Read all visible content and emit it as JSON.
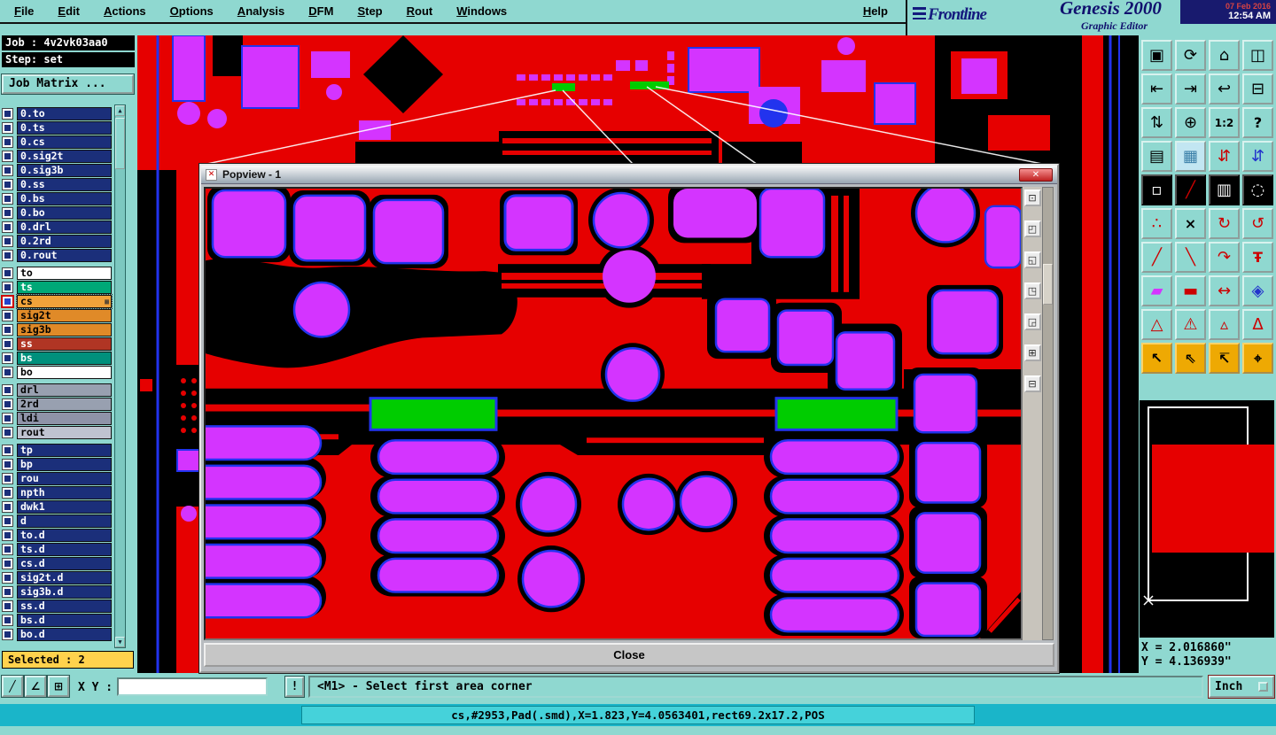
{
  "colors": {
    "desktop": "#8fd8d0",
    "copper_red": "#e60000",
    "pad_magenta": "#d434ff",
    "outline_blue": "#2233ee",
    "highlight_green": "#00cc00",
    "status_cyan": "#1ab5c9",
    "selected_yellow": "#ffd24d",
    "layer_navy": "#1b2f7a"
  },
  "menubar": {
    "items": [
      "File",
      "Edit",
      "Actions",
      "Options",
      "Analysis",
      "DFM",
      "Step",
      "Rout",
      "Windows"
    ],
    "help": "Help"
  },
  "brand": {
    "logo": "Frontline",
    "product": "Genesis 2000",
    "subtitle": "Graphic Editor",
    "date": "07 Feb 2016",
    "time": "12:54 AM"
  },
  "job_panel": {
    "job": "Job : 4v2vk03aa0",
    "step": "Step: set",
    "matrix_button": "Job Matrix ...",
    "selected": "Selected : 2"
  },
  "layers": {
    "scroll_up": "▲",
    "scroll_down": "▼",
    "cs_badge": "▦",
    "group1": [
      "0.to",
      "0.ts",
      "0.cs",
      "0.sig2t",
      "0.sig3b",
      "0.ss",
      "0.bs",
      "0.bo",
      "0.drl",
      "0.2rd",
      "0.rout"
    ],
    "group2": [
      "to",
      "ts",
      "cs",
      "sig2t",
      "sig3b",
      "ss",
      "bs",
      "bo"
    ],
    "group3": [
      "drl",
      "2rd",
      "ldi",
      "rout"
    ],
    "group4": [
      "tp",
      "bp",
      "rou",
      "npth",
      "dwk1",
      "d",
      "to.d",
      "ts.d",
      "cs.d",
      "sig2t.d",
      "sig3b.d",
      "ss.d",
      "bs.d",
      "bo.d"
    ]
  },
  "popview": {
    "title": "Popview - 1",
    "icon_glyph": "✕",
    "close_x": "✕",
    "close_label": "Close",
    "side_buttons": [
      {
        "name": "popview-zoom-window",
        "glyph": "⊡"
      },
      {
        "name": "popview-pan-up-left",
        "glyph": "◰"
      },
      {
        "name": "popview-pan-down-left",
        "glyph": "◱"
      },
      {
        "name": "popview-pan-up-right",
        "glyph": "◳"
      },
      {
        "name": "popview-pan-down-right",
        "glyph": "◲"
      },
      {
        "name": "popview-zoom-in",
        "glyph": "⊞"
      },
      {
        "name": "popview-zoom-out",
        "glyph": "⊟"
      }
    ]
  },
  "toolbar": {
    "buttons": [
      {
        "name": "view-reset",
        "glyph": "▣"
      },
      {
        "name": "view-refresh",
        "glyph": "⟳"
      },
      {
        "name": "view-home",
        "glyph": "⌂"
      },
      {
        "name": "view-tile",
        "glyph": "◫"
      },
      {
        "name": "pan-left",
        "glyph": "⇤"
      },
      {
        "name": "pan-right",
        "glyph": "⇥"
      },
      {
        "name": "zoom-previous",
        "glyph": "↩"
      },
      {
        "name": "view-minimize",
        "glyph": "⊟"
      },
      {
        "name": "zoom-in-out",
        "glyph": "⇅"
      },
      {
        "name": "zoom-center",
        "glyph": "⊕"
      },
      {
        "name": "zoom-1-2",
        "glyph": "1:2"
      },
      {
        "name": "help",
        "glyph": "?"
      },
      {
        "name": "print-screen",
        "glyph": "▤"
      },
      {
        "name": "grid-toggle",
        "glyph": "▦"
      },
      {
        "name": "flip-top-bottom",
        "glyph": "⇵"
      },
      {
        "name": "flip-bottom-top",
        "glyph": "⇵"
      },
      {
        "name": "negative-mode",
        "glyph": "▫"
      },
      {
        "name": "highlight-lines",
        "glyph": "╱"
      },
      {
        "name": "ruler",
        "glyph": "▥"
      },
      {
        "name": "circle-guide",
        "glyph": "◌"
      },
      {
        "name": "show-nets",
        "glyph": "∴"
      },
      {
        "name": "clear-highlight",
        "glyph": "×"
      },
      {
        "name": "rotate-cw",
        "glyph": "↻"
      },
      {
        "name": "rotate-ccw",
        "glyph": "↺"
      },
      {
        "name": "draw-line",
        "glyph": "╱"
      },
      {
        "name": "draw-line-2",
        "glyph": "╲"
      },
      {
        "name": "draw-arc",
        "glyph": "↷"
      },
      {
        "name": "draw-text",
        "glyph": "Ŧ"
      },
      {
        "name": "pad-tool",
        "glyph": "▰"
      },
      {
        "name": "slot-tool",
        "glyph": "▬"
      },
      {
        "name": "measure-tool",
        "glyph": "↔"
      },
      {
        "name": "shape-tool",
        "glyph": "◈"
      },
      {
        "name": "drc-triangle-1",
        "glyph": "△"
      },
      {
        "name": "drc-triangle-2",
        "glyph": "⚠"
      },
      {
        "name": "drc-triangle-3",
        "glyph": "▵"
      },
      {
        "name": "drc-triangle-4",
        "glyph": "Δ"
      },
      {
        "name": "select-pointer",
        "glyph": "↖"
      },
      {
        "name": "select-window",
        "glyph": "⇖"
      },
      {
        "name": "select-reference",
        "glyph": "↸"
      },
      {
        "name": "select-target",
        "glyph": "⌖"
      }
    ]
  },
  "nav_coords": {
    "x": "X = 2.016860\"",
    "y": "Y = 4.136939\""
  },
  "bottom": {
    "tools": [
      {
        "name": "line-tool",
        "glyph": "╱"
      },
      {
        "name": "angle-tool",
        "glyph": "∠"
      },
      {
        "name": "grid-tool",
        "glyph": "⊞"
      }
    ],
    "xy_label": "X Y :",
    "xy_value": "",
    "alert": "!",
    "prompt": "<M1> - Select first area corner",
    "units": "Inch"
  },
  "status": {
    "message": "cs,#2953,Pad(.smd),X=1.823,Y=4.0563401,rect69.2x17.2,POS"
  }
}
